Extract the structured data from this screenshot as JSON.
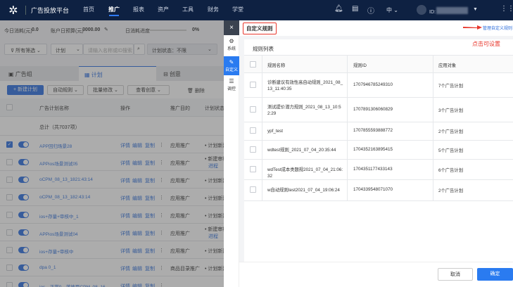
{
  "topnav": {
    "brand": "广告投放平台",
    "items": [
      "首页",
      "推广",
      "报表",
      "资产",
      "工具",
      "财务",
      "学堂"
    ],
    "active": 1,
    "lang": "中",
    "user_id": "ID:"
  },
  "stats": {
    "today_cost_label": "今日消耗(元)",
    "today_cost": "0.0",
    "budget_label": "账户日预算(元)",
    "budget": "3000.00",
    "progress_label": "日消耗进度",
    "progress": "0%",
    "progress_value": 0
  },
  "filters": {
    "all_filter": "所有筛选",
    "level": "计划",
    "search_placeholder": "请输入名称或ID搜索",
    "status": "计划状态：不限"
  },
  "tabs": [
    "广告组",
    "计划",
    "创意"
  ],
  "toolbar": {
    "new": "+ 新建计划",
    "auto": "自动规则",
    "batch": "批量修改",
    "view": "查看创意",
    "delete": "删除"
  },
  "table": {
    "headers": [
      "广告计划名称",
      "操作",
      "推广目的",
      "计划状态"
    ],
    "total": "总计（共7037项）",
    "actions": [
      "详情",
      "编辑",
      "复制"
    ],
    "rows": [
      {
        "name": "APP回归场景28",
        "purpose": "应用推广",
        "status": "计划新建",
        "checked": true
      },
      {
        "name": "APPios场景测试05",
        "purpose": "应用推广",
        "status": "新建审核",
        "status2": "进程",
        "checked": false
      },
      {
        "name": "oCPM_08_13_1821:43:14",
        "purpose": "应用推广",
        "status": "计划新建",
        "checked": false
      },
      {
        "name": "oCPM_08_13_182:43:14",
        "purpose": "应用推广",
        "status": "计划新建",
        "checked": false
      },
      {
        "name": "ios+存量+审核中_1",
        "purpose": "应用推广",
        "status": "计划新建",
        "checked": false
      },
      {
        "name": "APPios场景测试04",
        "purpose": "应用推广",
        "status": "新建审核",
        "status2": "进程",
        "checked": false
      },
      {
        "name": "ios+存量+审核中",
        "purpose": "应用推广",
        "status": "计划新建",
        "checked": false
      },
      {
        "name": "dpa 0_1",
        "purpose": "商品目录推广",
        "status": "计划新建",
        "checked": false
      },
      {
        "name": "ios—正常0—落地页CPM_08_16",
        "purpose": "",
        "status": "",
        "checked": false
      }
    ]
  },
  "drawer": {
    "close": "×",
    "tabs": [
      "系统",
      "自定义",
      "调控"
    ],
    "active": 1
  },
  "panel": {
    "title": "自定义规则",
    "manage_link": "管理自定义规则",
    "hint": "点击可设置",
    "card_title": "规则列表",
    "headers": [
      "规则名称",
      "规则ID",
      "应用对象"
    ],
    "rows": [
      {
        "name": "诊断建议有效性高自动规则_2021_08_13_11:40:35",
        "id": "1707946785249310",
        "target": "7个广告计划"
      },
      {
        "name": "测试提价潜力规则_2021_08_13_10:52:29",
        "id": "1707891306060829",
        "target": "3个广告计划"
      },
      {
        "name": "ypf_test",
        "id": "1707855593888772",
        "target": "2个广告计划"
      },
      {
        "name": "wdtest规则_2021_07_04_20:35:44",
        "id": "1704352163895415",
        "target": "5个广告计划"
      },
      {
        "name": "wdTest成本类题规2021_07_04_21:06:32",
        "id": "1704351177433143",
        "target": "6个广告计划"
      },
      {
        "name": "w自动规则test2021_07_04_19:06:24",
        "id": "1704339548071070",
        "target": "2个广告计划"
      }
    ],
    "cancel": "取消",
    "confirm": "确定"
  },
  "colors": {
    "nav": "#0e2142",
    "accent": "#2a6de0",
    "annotation": "#e8372c"
  }
}
